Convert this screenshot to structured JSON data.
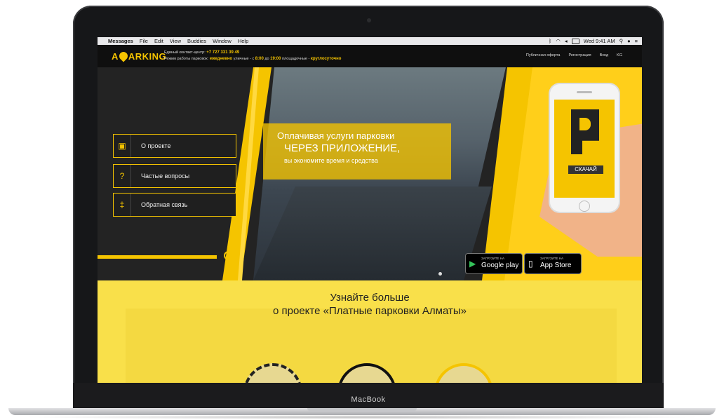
{
  "device": {
    "brand": "MacBook"
  },
  "menubar": {
    "app": "Messages",
    "items": [
      "File",
      "Edit",
      "View",
      "Buddies",
      "Window",
      "Help"
    ],
    "clock": "Wed 9:41 AM"
  },
  "header": {
    "logo_a": "A",
    "logo_rest": "ARKING",
    "contact_label": "Единый контакт-центр:",
    "phone": "+7 727 331 39 49",
    "hours_label": "Режим работы парковок:",
    "weekdays": "ежедневно",
    "street_label": "уличные - с",
    "time_from": "8:00",
    "to_label": "до",
    "time_to": "19:00",
    "lots_label": "площадочные -",
    "lots_hours": "круглосуточно",
    "nav": [
      "Публичная оферта",
      "Регистрация",
      "Вход",
      "KG"
    ]
  },
  "sidebar": {
    "items": [
      {
        "label": "О проекте",
        "icon": "id-card-icon"
      },
      {
        "label": "Частые вопросы",
        "icon": "question-bubble-icon"
      },
      {
        "label": "Обратная связь",
        "icon": "signpost-icon"
      }
    ]
  },
  "hero": {
    "line1": "Оплачивая услуги парковки",
    "line2": "ЧЕРЕЗ ПРИЛОЖЕНИЕ,",
    "line3": "вы экономите время и средства",
    "phone_button": "СКАЧАЙ",
    "google_small": "ЗАГРУЗИТЕ НА",
    "google_big": "Google play",
    "apple_small": "ЗАГРУЗИТЕ НА",
    "apple_big": "App Store"
  },
  "lower": {
    "line1": "Узнайте больше",
    "line2": "о проекте «Платные парковки Алматы»"
  },
  "colors": {
    "accent": "#f5c400",
    "dark": "#232323"
  }
}
